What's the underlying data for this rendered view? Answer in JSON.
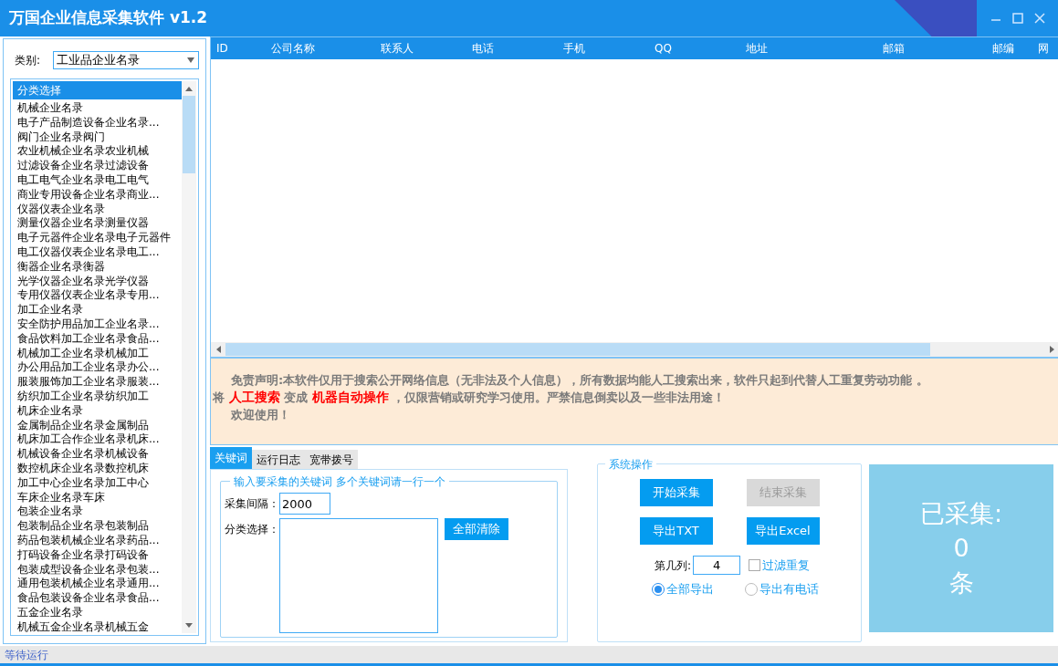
{
  "window": {
    "title": "万国企业信息采集软件 v1.2"
  },
  "category": {
    "label": "类别:",
    "value": "工业品企业名录"
  },
  "list": {
    "header": "分类选择",
    "items": [
      "机械企业名录",
      "电子产品制造设备企业名录...",
      "阀门企业名录阀门",
      "农业机械企业名录农业机械",
      "过滤设备企业名录过滤设备",
      "电工电气企业名录电工电气",
      "商业专用设备企业名录商业...",
      "仪器仪表企业名录",
      "测量仪器企业名录测量仪器",
      "电子元器件企业名录电子元器件",
      "电工仪器仪表企业名录电工...",
      "衡器企业名录衡器",
      "光学仪器企业名录光学仪器",
      "专用仪器仪表企业名录专用...",
      "加工企业名录",
      "安全防护用品加工企业名录...",
      "食品饮料加工企业名录食品...",
      "机械加工企业名录机械加工",
      "办公用品加工企业名录办公...",
      "服装服饰加工企业名录服装...",
      "纺织加工企业名录纺织加工",
      "机床企业名录",
      "金属制品企业名录金属制品",
      "机床加工合作企业名录机床...",
      "机械设备企业名录机械设备",
      "数控机床企业名录数控机床",
      "加工中心企业名录加工中心",
      "车床企业名录车床",
      "包装企业名录",
      "包装制品企业名录包装制品",
      "药品包装机械企业名录药品...",
      "打码设备企业名录打码设备",
      "包装成型设备企业名录包装...",
      "通用包装机械企业名录通用...",
      "食品包装设备企业名录食品...",
      "五金企业名录",
      "机械五金企业名录机械五金"
    ]
  },
  "table": {
    "columns": [
      "ID",
      "公司名称",
      "联系人",
      "电话",
      "手机",
      "QQ",
      "地址",
      "邮箱",
      "邮编",
      "网"
    ]
  },
  "disclaimer": {
    "lines": [
      "免责声明:本软件仅用于搜索公开网络信息（无非法及个人信息），所有数据均能人工搜索出来，软件只起到代替人工重复劳动功能 。",
      "将 **人工搜索** 变成 **机器自动操作** ，仅限营销或研究学习使用。严禁信息倒卖以及一些非法用途！",
      "欢迎使用！"
    ]
  },
  "tabs": [
    {
      "label": "关键词",
      "selected": true
    },
    {
      "label": "运行日志",
      "selected": false
    },
    {
      "label": "宽带拨号",
      "selected": false
    }
  ],
  "keywords": {
    "legend": "输入要采集的关键词 多个关键词请一行一个",
    "interval_label": "采集间隔：",
    "interval_value": "2000",
    "category_label": "分类选择：",
    "clear_button": "全部清除"
  },
  "system": {
    "legend": "系统操作",
    "buttons": [
      {
        "label": "开始采集",
        "disabled": false
      },
      {
        "label": "结束采集",
        "disabled": true
      },
      {
        "label": "导出TXT",
        "disabled": false
      },
      {
        "label": "导出Excel",
        "disabled": false
      }
    ],
    "column_label": "第几列:",
    "column_value": "4",
    "filter": {
      "label": "过滤重复",
      "checked": false
    },
    "export_options": [
      {
        "label": "全部导出",
        "selected": true
      },
      {
        "label": "导出有电话",
        "selected": false
      }
    ]
  },
  "counter": {
    "label": "已采集:",
    "count": "0",
    "unit": "条"
  },
  "status_bar": "等待运行"
}
